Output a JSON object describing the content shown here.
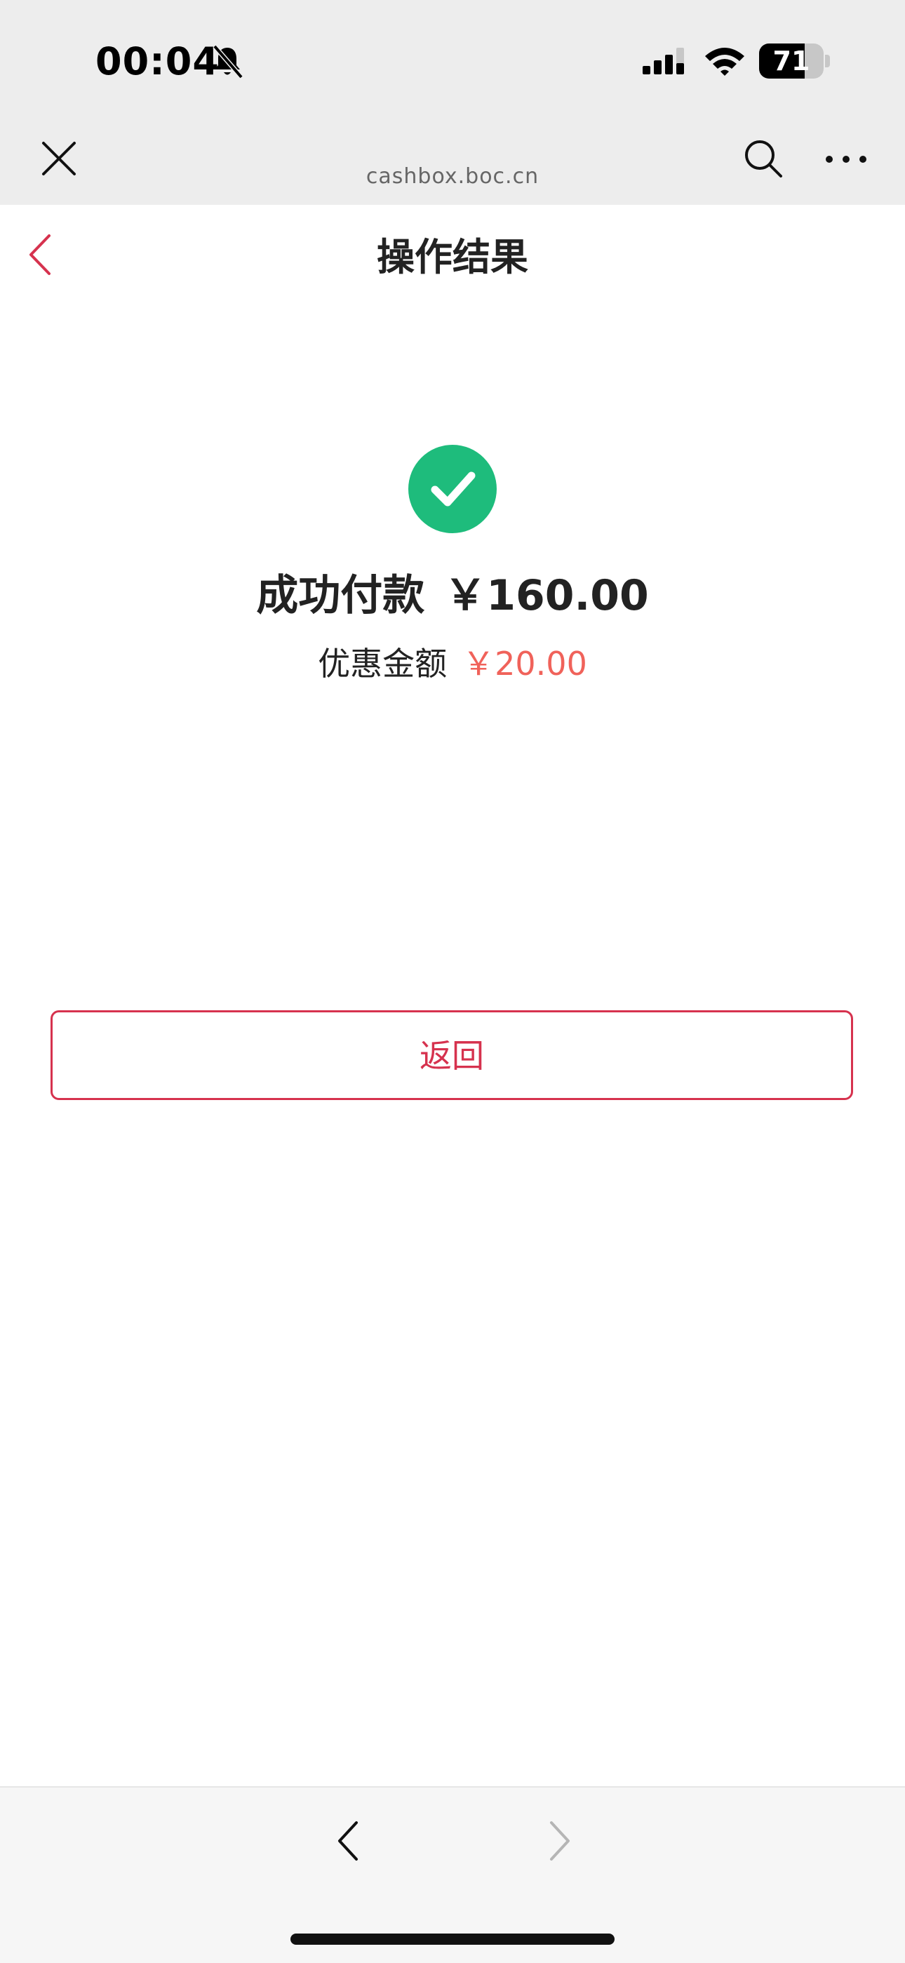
{
  "status_bar": {
    "time": "00:04",
    "battery_level": "71",
    "battery_fraction": 0.71,
    "icons": [
      "bell-slash-icon",
      "signal-icon",
      "wifi-icon",
      "battery-icon"
    ]
  },
  "webview_bar": {
    "domain": "cashbox.boc.cn",
    "icons": [
      "close-icon",
      "search-icon",
      "more-icon"
    ]
  },
  "header": {
    "title": "操作结果",
    "back_icon": "chevron-left-icon"
  },
  "result": {
    "status_icon": "check-circle-icon",
    "label": "成功付款",
    "amount": "￥160.00",
    "discount_label": "优惠金额",
    "discount_amount": "￥20.00"
  },
  "actions": {
    "return_label": "返回"
  },
  "bottom_bar": {
    "icons": [
      "nav-back-icon",
      "nav-forward-icon"
    ]
  },
  "colors": {
    "accent": "#d6324e",
    "success": "#1ebc7c",
    "discount": "#f0625a",
    "chrome_bg": "#ededed"
  }
}
